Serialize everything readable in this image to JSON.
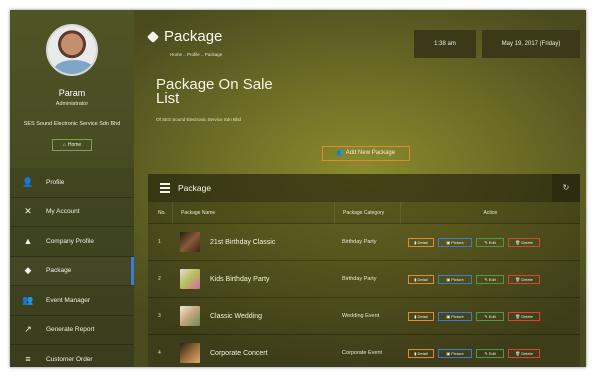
{
  "sidebar": {
    "user": {
      "name": "Param",
      "role": "Administrator",
      "company": "SES Sound Electronic Service Sdn Bhd"
    },
    "home_label": "Home",
    "menu": [
      {
        "label": "Profile",
        "icon": "user-icon"
      },
      {
        "label": "My Account",
        "icon": "tools-icon"
      },
      {
        "label": "Company Profile",
        "icon": "building-icon"
      },
      {
        "label": "Package",
        "icon": "cube-icon",
        "active": true
      },
      {
        "label": "Event Manager",
        "icon": "users-icon"
      },
      {
        "label": "Generate Report",
        "icon": "chart-line-icon"
      },
      {
        "label": "Customer Order",
        "icon": "list-icon"
      }
    ]
  },
  "header": {
    "title": "Package",
    "breadcrumb": "Home .. Profile .. Package",
    "time": "1:38 am",
    "date": "May 19, 2017 (Friday)"
  },
  "content": {
    "section_title": "Package On Sale List",
    "company_line": "Of SES Sound Electronic Service Sdn Bhd",
    "add_button": "Add New Package"
  },
  "table": {
    "panel_title": "Package",
    "columns": {
      "no": "No.",
      "name": "Package Name",
      "category": "Package Category",
      "action": "Action"
    },
    "actions": {
      "detail": "Detail",
      "picture": "Picture",
      "edit": "Edit",
      "delete": "Delete"
    },
    "rows": [
      {
        "no": "1",
        "name": "21st Birthday Classic",
        "category": "Birthday Party",
        "thumb": "#5a3b2a"
      },
      {
        "no": "2",
        "name": "Kids Birthday Party",
        "category": "Birthday Party",
        "thumb": "#b8c35a"
      },
      {
        "no": "3",
        "name": "Classic Wedding",
        "category": "Wedding Event",
        "thumb": "#d8c9a2"
      },
      {
        "no": "4",
        "name": "Corporate Concert",
        "category": "Corporate Event",
        "thumb": "#6a4a2a"
      }
    ]
  },
  "colors": {
    "accent_active": "#3a7bd5",
    "detail": "#e08a36",
    "picture": "#3a7bd5",
    "edit": "#4f9a4a",
    "delete": "#d9452e"
  }
}
